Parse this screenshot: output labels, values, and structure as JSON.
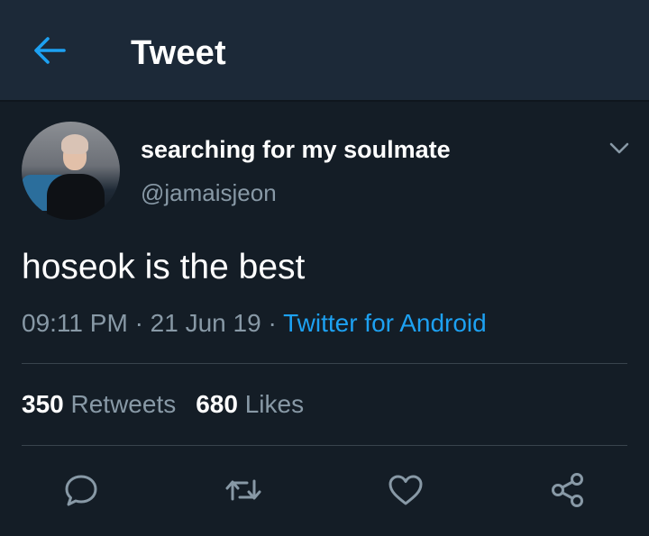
{
  "header": {
    "title": "Tweet",
    "back_icon": "arrow-left-icon",
    "accent": "#1da1f2"
  },
  "tweet": {
    "display_name": "searching for my soulmate",
    "handle": "@jamaisjeon",
    "text": "hoseok is the best",
    "time": "09:11 PM",
    "date": "21 Jun 19",
    "separator": "·",
    "source": "Twitter for Android",
    "retweets_count": "350",
    "retweets_label": "Retweets",
    "likes_count": "680",
    "likes_label": "Likes"
  },
  "actions": [
    {
      "name": "reply",
      "icon": "reply-icon"
    },
    {
      "name": "retweet",
      "icon": "retweet-icon"
    },
    {
      "name": "like",
      "icon": "heart-icon"
    },
    {
      "name": "share",
      "icon": "share-icon"
    }
  ],
  "colors": {
    "background": "#141d26",
    "header_bg": "#1c2938",
    "secondary_text": "#8899a6",
    "link": "#1da1f2",
    "divider": "#38444d"
  }
}
